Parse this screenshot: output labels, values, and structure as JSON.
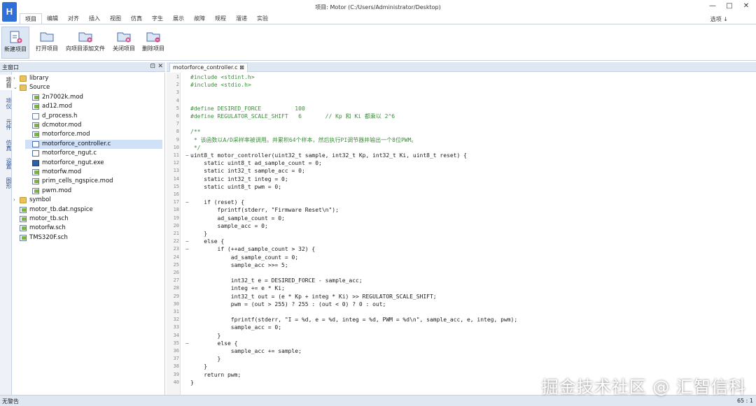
{
  "window": {
    "title": "项目: Motor (C:/Users/Administrator/Desktop)",
    "app_icon_text": "H",
    "minimize": "—",
    "maximize": "□",
    "close": "✕"
  },
  "menu": {
    "items": [
      "项目",
      "编辑",
      "对齐",
      "插入",
      "视图",
      "仿真",
      "字生",
      "展示",
      "故障",
      "规程",
      "溜递",
      "实验"
    ],
    "active_index": 0,
    "right_label": "选项 ↓"
  },
  "ribbon": {
    "buttons": [
      {
        "label": "新建项目",
        "icon": "new-project-icon",
        "selected": true
      },
      {
        "label": "打开项目",
        "icon": "open-project-icon",
        "selected": false
      },
      {
        "label": "向项目添加文件",
        "icon": "add-file-icon",
        "selected": false
      },
      {
        "label": "关闭项目",
        "icon": "close-project-icon",
        "selected": false
      },
      {
        "label": "删除项目",
        "icon": "delete-project-icon",
        "selected": false
      }
    ]
  },
  "sidebar": {
    "title": "主窗口",
    "pin": "⊡",
    "close": "✕",
    "vertical_tabs": [
      "项目",
      "项仪",
      "元件",
      "仿真",
      "设置",
      "图形"
    ],
    "tree": [
      {
        "label": "library",
        "type": "folder",
        "level": 0,
        "expander": "›"
      },
      {
        "label": "Source",
        "type": "folder",
        "level": 0,
        "expander": "⌄"
      },
      {
        "label": "2n7002k.mod",
        "type": "mod",
        "level": 1
      },
      {
        "label": "ad12.mod",
        "type": "mod",
        "level": 1
      },
      {
        "label": "d_process.h",
        "type": "file",
        "level": 1
      },
      {
        "label": "dcmotor.mod",
        "type": "mod",
        "level": 1
      },
      {
        "label": "motorforce.mod",
        "type": "mod",
        "level": 1
      },
      {
        "label": "motorforce_controller.c",
        "type": "c",
        "level": 1,
        "selected": true
      },
      {
        "label": "motorforce_ngut.c",
        "type": "c",
        "level": 1
      },
      {
        "label": "motorforce_ngut.exe",
        "type": "exe",
        "level": 1
      },
      {
        "label": "motorfw.mod",
        "type": "mod",
        "level": 1
      },
      {
        "label": "prim_cells_ngspice.mod",
        "type": "mod",
        "level": 1
      },
      {
        "label": "pwm.mod",
        "type": "mod",
        "level": 1
      },
      {
        "label": "symbol",
        "type": "folder",
        "level": 0,
        "expander": "›"
      },
      {
        "label": "motor_tb.dat.ngspice",
        "type": "mod",
        "level": 0
      },
      {
        "label": "motor_tb.sch",
        "type": "mod",
        "level": 0
      },
      {
        "label": "motorfw.sch",
        "type": "mod",
        "level": 0
      },
      {
        "label": "TMS320F.sch",
        "type": "mod",
        "level": 0
      }
    ]
  },
  "editor": {
    "tab_label": "motorforce_controller.c ⊠",
    "lines": [
      {
        "n": "1",
        "fold": "",
        "code": "#include <stdint.h>",
        "cls": "pp"
      },
      {
        "n": "2",
        "fold": "",
        "code": "#include <stdio.h>",
        "cls": "pp"
      },
      {
        "n": "3",
        "fold": "",
        "code": "",
        "cls": ""
      },
      {
        "n": "4",
        "fold": "",
        "code": "",
        "cls": ""
      },
      {
        "n": "5",
        "fold": "",
        "code": "#define DESIRED_FORCE          100",
        "cls": "pp"
      },
      {
        "n": "6",
        "fold": "",
        "code": "#define REGULATOR_SCALE_SHIFT   6       // Kp 和 Ki 都乘以 2^6",
        "cls": "pp"
      },
      {
        "n": "7",
        "fold": "",
        "code": "",
        "cls": ""
      },
      {
        "n": "8",
        "fold": "",
        "code": "/**",
        "cls": "cm"
      },
      {
        "n": "9",
        "fold": "",
        "code": " * 该函数以A/D采样率被调用。并累积64个样本，然后执行PI调节器并输出一个8位PWM。",
        "cls": "cm"
      },
      {
        "n": "10",
        "fold": "",
        "code": " */",
        "cls": "cm"
      },
      {
        "n": "11",
        "fold": "−",
        "code": "uint8_t motor_controller(uint32_t sample, int32_t Kp, int32_t Ki, uint8_t reset) {",
        "cls": ""
      },
      {
        "n": "12",
        "fold": "",
        "code": "    static uint8_t ad_sample_count = 0;",
        "cls": ""
      },
      {
        "n": "13",
        "fold": "",
        "code": "    static int32_t sample_acc = 0;",
        "cls": ""
      },
      {
        "n": "14",
        "fold": "",
        "code": "    static int32_t integ = 0;",
        "cls": ""
      },
      {
        "n": "15",
        "fold": "",
        "code": "    static uint8_t pwm = 0;",
        "cls": ""
      },
      {
        "n": "16",
        "fold": "",
        "code": "",
        "cls": ""
      },
      {
        "n": "17",
        "fold": "−",
        "code": "    if (reset) {",
        "cls": ""
      },
      {
        "n": "18",
        "fold": "",
        "code": "        fprintf(stderr, \"Firmware Reset\\n\");",
        "cls": ""
      },
      {
        "n": "19",
        "fold": "",
        "code": "        ad_sample_count = 0;",
        "cls": ""
      },
      {
        "n": "20",
        "fold": "",
        "code": "        sample_acc = 0;",
        "cls": ""
      },
      {
        "n": "21",
        "fold": "",
        "code": "    }",
        "cls": ""
      },
      {
        "n": "22",
        "fold": "−",
        "code": "    else {",
        "cls": ""
      },
      {
        "n": "23",
        "fold": "−",
        "code": "        if (++ad_sample_count > 32) {",
        "cls": ""
      },
      {
        "n": "24",
        "fold": "",
        "code": "            ad_sample_count = 0;",
        "cls": ""
      },
      {
        "n": "25",
        "fold": "",
        "code": "            sample_acc >>= 5;",
        "cls": ""
      },
      {
        "n": "26",
        "fold": "",
        "code": "",
        "cls": ""
      },
      {
        "n": "27",
        "fold": "",
        "code": "            int32_t e = DESIRED_FORCE - sample_acc;",
        "cls": ""
      },
      {
        "n": "28",
        "fold": "",
        "code": "            integ += e * Ki;",
        "cls": ""
      },
      {
        "n": "29",
        "fold": "",
        "code": "            int32_t out = (e * Kp + integ * Ki) >> REGULATOR_SCALE_SHIFT;",
        "cls": ""
      },
      {
        "n": "30",
        "fold": "",
        "code": "            pwm = (out > 255) ? 255 : (out < 0) ? 0 : out;",
        "cls": ""
      },
      {
        "n": "31",
        "fold": "",
        "code": "",
        "cls": ""
      },
      {
        "n": "32",
        "fold": "",
        "code": "            fprintf(stderr, \"I = %d, e = %d, integ = %d, PWM = %d\\n\", sample_acc, e, integ, pwm);",
        "cls": ""
      },
      {
        "n": "33",
        "fold": "",
        "code": "            sample_acc = 0;",
        "cls": ""
      },
      {
        "n": "34",
        "fold": "",
        "code": "        }",
        "cls": ""
      },
      {
        "n": "35",
        "fold": "−",
        "code": "        else {",
        "cls": ""
      },
      {
        "n": "36",
        "fold": "",
        "code": "            sample_acc += sample;",
        "cls": ""
      },
      {
        "n": "37",
        "fold": "",
        "code": "        }",
        "cls": ""
      },
      {
        "n": "38",
        "fold": "",
        "code": "    }",
        "cls": ""
      },
      {
        "n": "39",
        "fold": "",
        "code": "    return pwm;",
        "cls": ""
      },
      {
        "n": "40",
        "fold": "",
        "code": "}",
        "cls": ""
      }
    ]
  },
  "status": {
    "left": "无警告",
    "right": "65 : 1"
  },
  "watermark": "掘金技术社区 @ 汇智信科",
  "colors": {
    "accent": "#2e6fd8",
    "panel": "#dfe7f2",
    "selection": "#cfe0f7",
    "preprocessor": "#3a8d3a"
  }
}
